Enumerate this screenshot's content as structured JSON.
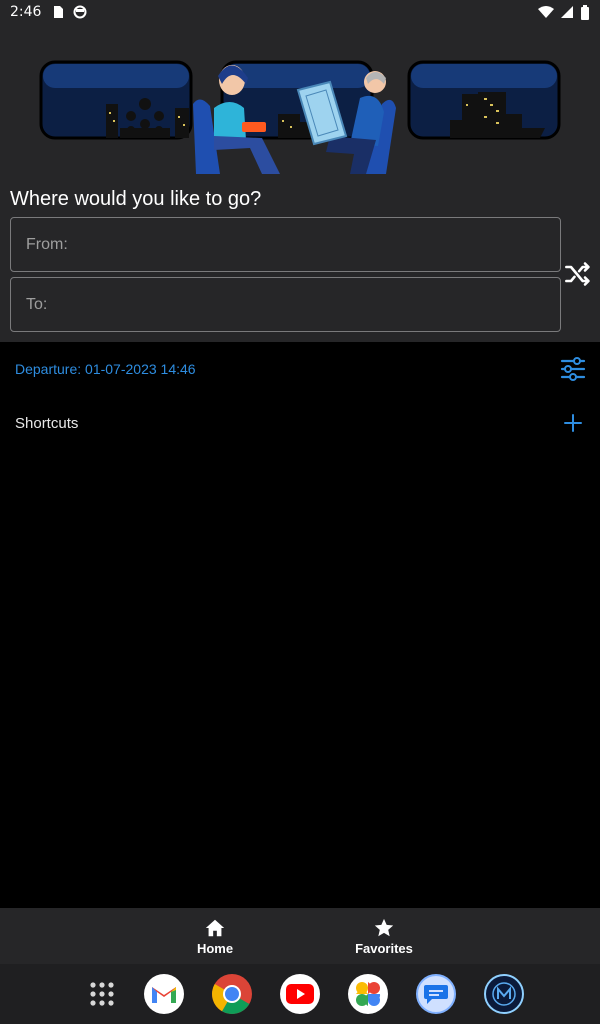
{
  "statusbar": {
    "time": "2:46"
  },
  "header": {
    "prompt": "Where would you like to go?"
  },
  "search": {
    "from_placeholder": "From:",
    "to_placeholder": "To:"
  },
  "departure": {
    "label": "Departure: 01-07-2023 14:46"
  },
  "shortcuts": {
    "label": "Shortcuts"
  },
  "bottom_nav": {
    "items": [
      {
        "label": "Home",
        "icon": "home-icon"
      },
      {
        "label": "Favorites",
        "icon": "star-icon"
      }
    ]
  },
  "dock": {
    "apps": [
      "app-drawer-icon",
      "gmail-icon",
      "chrome-icon",
      "youtube-icon",
      "photos-icon",
      "messages-icon",
      "metro-app-icon"
    ]
  },
  "colors": {
    "accent": "#2e8de0",
    "surface": "#262628",
    "background": "#000000"
  }
}
